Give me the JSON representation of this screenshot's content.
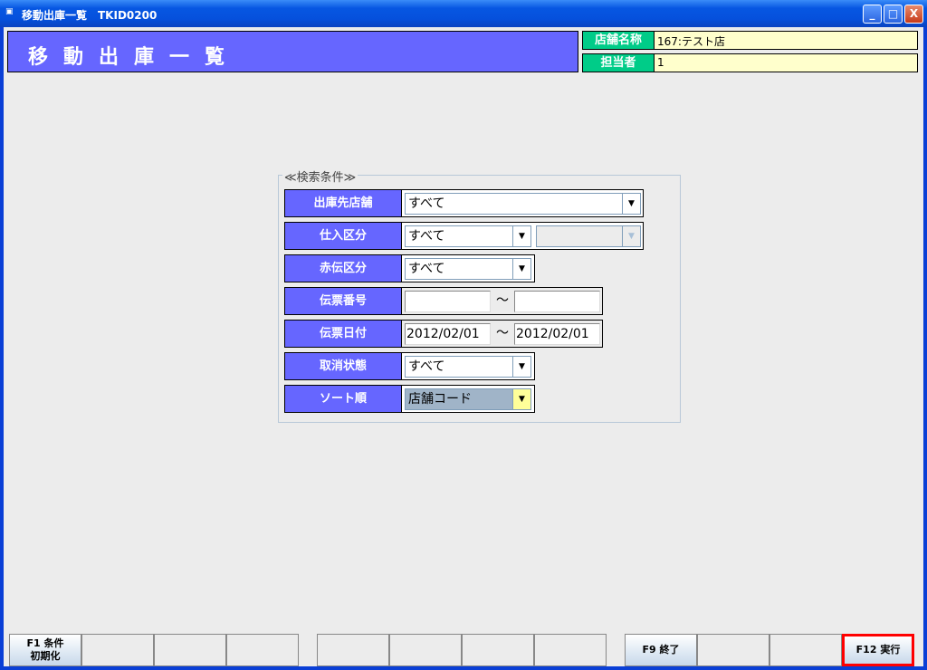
{
  "window": {
    "title": "移動出庫一覧　TKID0200",
    "icon": "app-icon",
    "minimize": "_",
    "maximize": "□",
    "close": "X"
  },
  "header": {
    "title": "移動出庫一覧",
    "store_label": "店舗名称",
    "store_value": "167:テスト店",
    "staff_label": "担当者",
    "staff_value": "1"
  },
  "search": {
    "title": "≪検索条件≫",
    "rows": [
      {
        "label": "出庫先店舗",
        "value": "すべて"
      },
      {
        "label": "仕入区分",
        "value": "すべて",
        "value2": ""
      },
      {
        "label": "赤伝区分",
        "value": "すべて"
      },
      {
        "label": "伝票番号",
        "from": "",
        "to": ""
      },
      {
        "label": "伝票日付",
        "from": "2012/02/01",
        "to": "2012/02/01"
      },
      {
        "label": "取消状態",
        "value": "すべて"
      },
      {
        "label": "ソート順",
        "value": "店舗コード"
      }
    ],
    "tilde": "～",
    "arrow": "▼"
  },
  "fkeys": {
    "f1": "F1 条件\n初期化",
    "f9": "F9 終了",
    "f12": "F12 実行"
  },
  "colors": {
    "header": "#6666ff",
    "label_green": "#00cc88",
    "value_bg": "#ffffcc",
    "sort_bg": "#a0b4c8",
    "sort_btn": "#ffff99"
  }
}
